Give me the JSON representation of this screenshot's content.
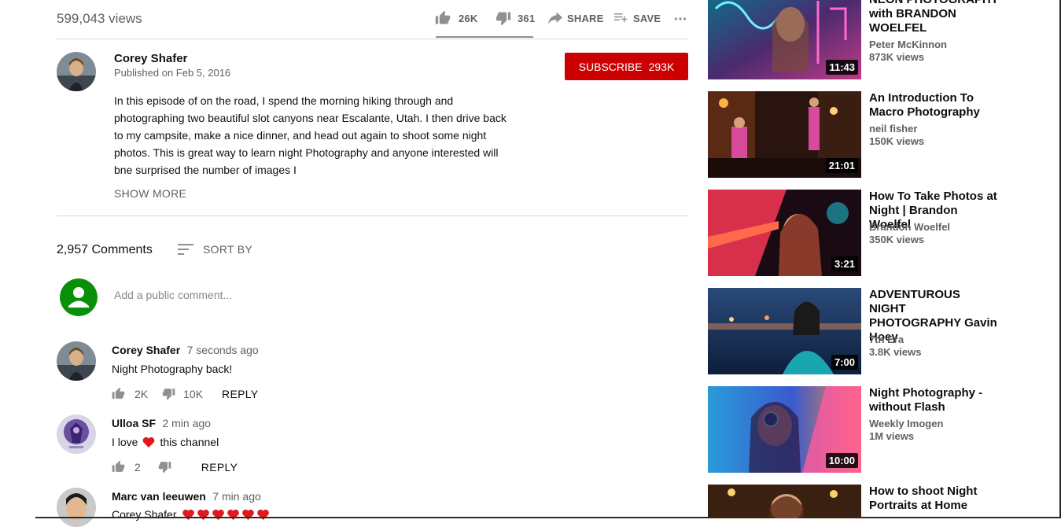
{
  "video": {
    "views": "599,043 views",
    "likes": "26K",
    "dislikes": "361",
    "share_label": "SHARE",
    "save_label": "SAVE"
  },
  "channel": {
    "name": "Corey Shafer",
    "published": "Published on Feb 5, 2016",
    "subscribe_label": "SUBSCRIBE",
    "subscriber_count": "293K"
  },
  "description": {
    "lines": [
      "In this episode of on the road, I spend the morning hiking through and",
      "photographing two beautiful slot canyons near Escalante, Utah. I then drive back",
      "to my campsite, make a nice dinner, and head out again to shoot some night",
      "photos. This is great way to learn night Photography and anyone interested will",
      "bne surprised the number of images I"
    ],
    "show_more": "SHOW MORE"
  },
  "comments_section": {
    "count": "2,957 Comments",
    "sort_label": "SORT BY",
    "add_placeholder": "Add a public comment..."
  },
  "comments": [
    {
      "author": "Corey Shafer",
      "time": "7 seconds ago",
      "text": "Night Photography back!",
      "likes": "2K",
      "dislikes": "10K",
      "reply": "REPLY"
    },
    {
      "author": "Ulloa SF",
      "time": "2 min ago",
      "text_before": "I love",
      "text_after": "this channel",
      "likes": "2",
      "reply": "REPLY"
    },
    {
      "author": "Marc van leeuwen",
      "time": "7 min ago",
      "text": "Corey Shafer"
    }
  ],
  "related": [
    {
      "title": "NEON PHOTOGRAPHY with BRANDON WOELFEL",
      "channel": "Peter McKinnon",
      "views": "873K views",
      "duration": "11:43"
    },
    {
      "title": "An Introduction To Macro Photography",
      "channel": "neil fisher",
      "views": "150K views",
      "duration": "21:01"
    },
    {
      "title": "How To Take Photos at Night | Brandon Woelfel",
      "channel": "Brandon Woelfel",
      "views": "350K views",
      "duration": "3:21"
    },
    {
      "title": "ADVENTUROUS NIGHT PHOTOGRAPHY Gavin Hoey",
      "channel": "7th Era",
      "views": "3.8K views",
      "duration": "7:00"
    },
    {
      "title": "Night Photography - without Flash",
      "channel": "Weekly Imogen",
      "views": "1M views",
      "duration": "10:00"
    },
    {
      "title": "How to shoot Night Portraits at Home",
      "channel": "",
      "views": "",
      "duration": ""
    }
  ],
  "colors": {
    "subscribe_red": "#cc0000",
    "avatar_green": "#0a8f08",
    "heart_red": "#e0191f"
  }
}
